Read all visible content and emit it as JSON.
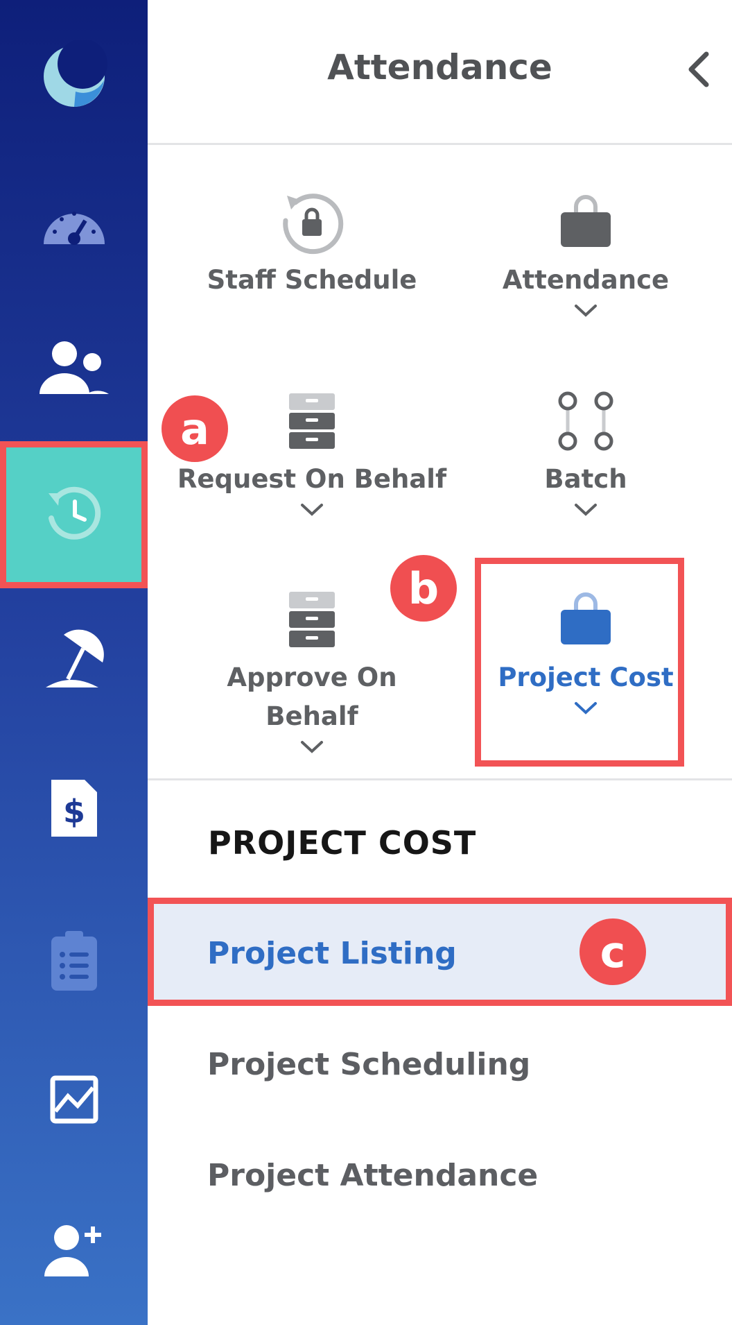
{
  "panel": {
    "title": "Attendance"
  },
  "tiles": {
    "staff_schedule": "Staff Schedule",
    "attendance": "Attendance",
    "request_on_behalf": "Request On Behalf",
    "batch": "Batch",
    "approve_on_behalf_line1": "Approve On",
    "approve_on_behalf_line2": "Behalf",
    "project_cost": "Project Cost"
  },
  "section": {
    "title": "PROJECT COST",
    "items": [
      "Project Listing",
      "Project Scheduling",
      "Project Attendance"
    ]
  },
  "annotations": {
    "a": "a",
    "b": "b",
    "c": "c"
  },
  "colors": {
    "sidebar_top": "#0e1f7a",
    "sidebar_bottom": "#3a72c6",
    "active_teal": "#55d0c6",
    "highlight_red": "#f25355",
    "accent_blue": "#2f6dc4",
    "selected_bg": "#e6ecf7"
  },
  "icons": {
    "sidebar": [
      "moon-logo-icon",
      "dashboard-gauge-icon",
      "people-icon",
      "attendance-history-icon",
      "beach-umbrella-icon",
      "payroll-dollar-icon",
      "clipboard-list-icon",
      "chart-icon",
      "add-user-icon"
    ],
    "tiles": [
      "lock-refresh-icon",
      "briefcase-icon",
      "cabinet-icon",
      "batch-nodes-icon",
      "cabinet-icon",
      "briefcase-icon"
    ]
  }
}
